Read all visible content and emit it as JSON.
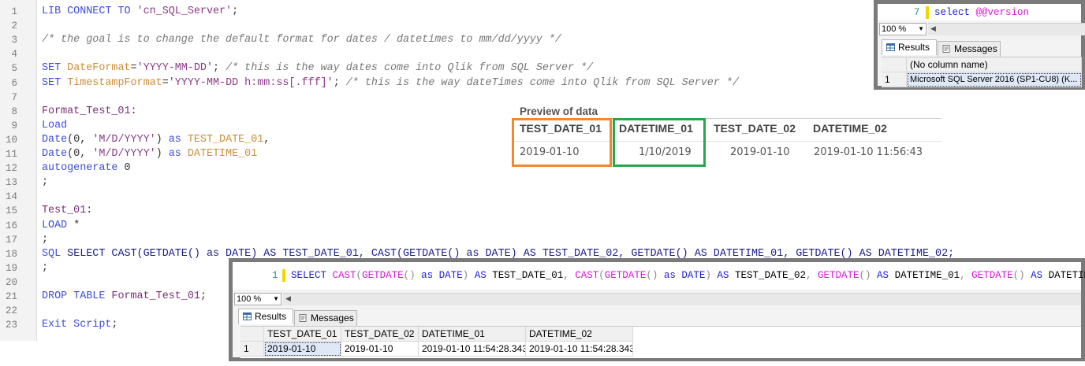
{
  "script_editor": {
    "lines": [
      {
        "n": "1",
        "seg": [
          [
            "kw",
            "LIB CONNECT TO "
          ],
          [
            "str",
            "'cn_SQL_Server'"
          ],
          [
            "op",
            ";"
          ]
        ]
      },
      {
        "n": "2",
        "seg": []
      },
      {
        "n": "3",
        "seg": [
          [
            "cm",
            "/* the goal is to change the default format for dates / datetimes to mm/dd/yyyy */"
          ]
        ]
      },
      {
        "n": "4",
        "seg": []
      },
      {
        "n": "5",
        "seg": [
          [
            "kw",
            "SET "
          ],
          [
            "var",
            "DateFormat"
          ],
          [
            "op",
            "="
          ],
          [
            "str",
            "'YYYY-MM-DD'"
          ],
          [
            "op",
            "; "
          ],
          [
            "cm",
            "/* this is the way dates come into Qlik from SQL Server */"
          ]
        ]
      },
      {
        "n": "6",
        "seg": [
          [
            "kw",
            "SET "
          ],
          [
            "var",
            "TimestampFormat"
          ],
          [
            "op",
            "="
          ],
          [
            "str",
            "'YYYY-MM-DD h:mm:ss[.fff]'"
          ],
          [
            "op",
            "; "
          ],
          [
            "cm",
            "/* this is the way dateTimes come into Qlik from SQL Server */"
          ]
        ]
      },
      {
        "n": "7",
        "seg": []
      },
      {
        "n": "8",
        "seg": [
          [
            "lbl",
            "Format_Test_01"
          ],
          [
            "op",
            ":"
          ]
        ]
      },
      {
        "n": "9",
        "seg": [
          [
            "kw",
            "Load"
          ]
        ]
      },
      {
        "n": "10",
        "seg": [
          [
            "kw",
            "Date"
          ],
          [
            "op",
            "(0, "
          ],
          [
            "str",
            "'M/D/YYYY'"
          ],
          [
            "op",
            ") "
          ],
          [
            "kw",
            "as "
          ],
          [
            "var",
            "TEST_DATE_01"
          ],
          [
            "op",
            ","
          ]
        ]
      },
      {
        "n": "11",
        "seg": [
          [
            "kw",
            "Date"
          ],
          [
            "op",
            "(0, "
          ],
          [
            "str",
            "'M/D/YYYY'"
          ],
          [
            "op",
            ") "
          ],
          [
            "kw",
            "as "
          ],
          [
            "var",
            "DATETIME_01"
          ]
        ]
      },
      {
        "n": "12",
        "seg": [
          [
            "kw",
            "autogenerate "
          ],
          [
            "op",
            "0"
          ]
        ]
      },
      {
        "n": "13",
        "seg": [
          [
            "op",
            ";"
          ]
        ]
      },
      {
        "n": "14",
        "seg": []
      },
      {
        "n": "15",
        "seg": [
          [
            "lbl",
            "Test_01"
          ],
          [
            "op",
            ":"
          ]
        ]
      },
      {
        "n": "16",
        "seg": [
          [
            "kw",
            "LOAD "
          ],
          [
            "op",
            "*"
          ]
        ]
      },
      {
        "n": "17",
        "seg": [
          [
            "op",
            ";"
          ]
        ]
      },
      {
        "n": "18",
        "seg": [
          [
            "kw",
            "SQL "
          ],
          [
            "txt",
            "SELECT CAST(GETDATE() as DATE) AS TEST_DATE_01, CAST(GETDATE() as DATE) AS TEST_DATE_02, GETDATE() AS DATETIME_01, GETDATE() AS DATETIME_02;"
          ]
        ]
      },
      {
        "n": "19",
        "seg": [
          [
            "op",
            ";"
          ]
        ]
      },
      {
        "n": "20",
        "seg": []
      },
      {
        "n": "21",
        "seg": [
          [
            "kw",
            "DROP TABLE "
          ],
          [
            "lbl",
            "Format_Test_01"
          ],
          [
            "op",
            ";"
          ]
        ]
      },
      {
        "n": "22",
        "seg": []
      },
      {
        "n": "23",
        "seg": [
          [
            "kw",
            "Exit Script"
          ],
          [
            "op",
            ";"
          ]
        ]
      }
    ]
  },
  "preview": {
    "title": "Preview of data",
    "headers": [
      "TEST_DATE_01",
      "DATETIME_01",
      "TEST_DATE_02",
      "DATETIME_02"
    ],
    "row": [
      "2019-01-10",
      "1/10/2019",
      "2019-01-10",
      "2019-01-10 11:56:43"
    ],
    "highlight_colors": {
      "orange": "#f5882b",
      "green": "#24a84b"
    }
  },
  "ssms_version": {
    "line_number": "7",
    "query_keyword": "select",
    "query_variable": "@@version",
    "zoom": "100 %",
    "tabs": {
      "results": "Results",
      "messages": "Messages"
    },
    "column_header": "(No column name)",
    "row_number": "1",
    "cell_value": "Microsoft SQL Server 2016 (SP1-CU8) (K..."
  },
  "ssms_query": {
    "line_number": "1",
    "zoom": "100 %",
    "tabs": {
      "results": "Results",
      "messages": "Messages"
    },
    "headers": [
      "TEST_DATE_01",
      "TEST_DATE_02",
      "DATETIME_01",
      "DATETIME_02"
    ],
    "row_number": "1",
    "row": [
      "2019-01-10",
      "2019-01-10",
      "2019-01-10 11:54:28.343",
      "2019-01-10 11:54:28.343"
    ]
  }
}
